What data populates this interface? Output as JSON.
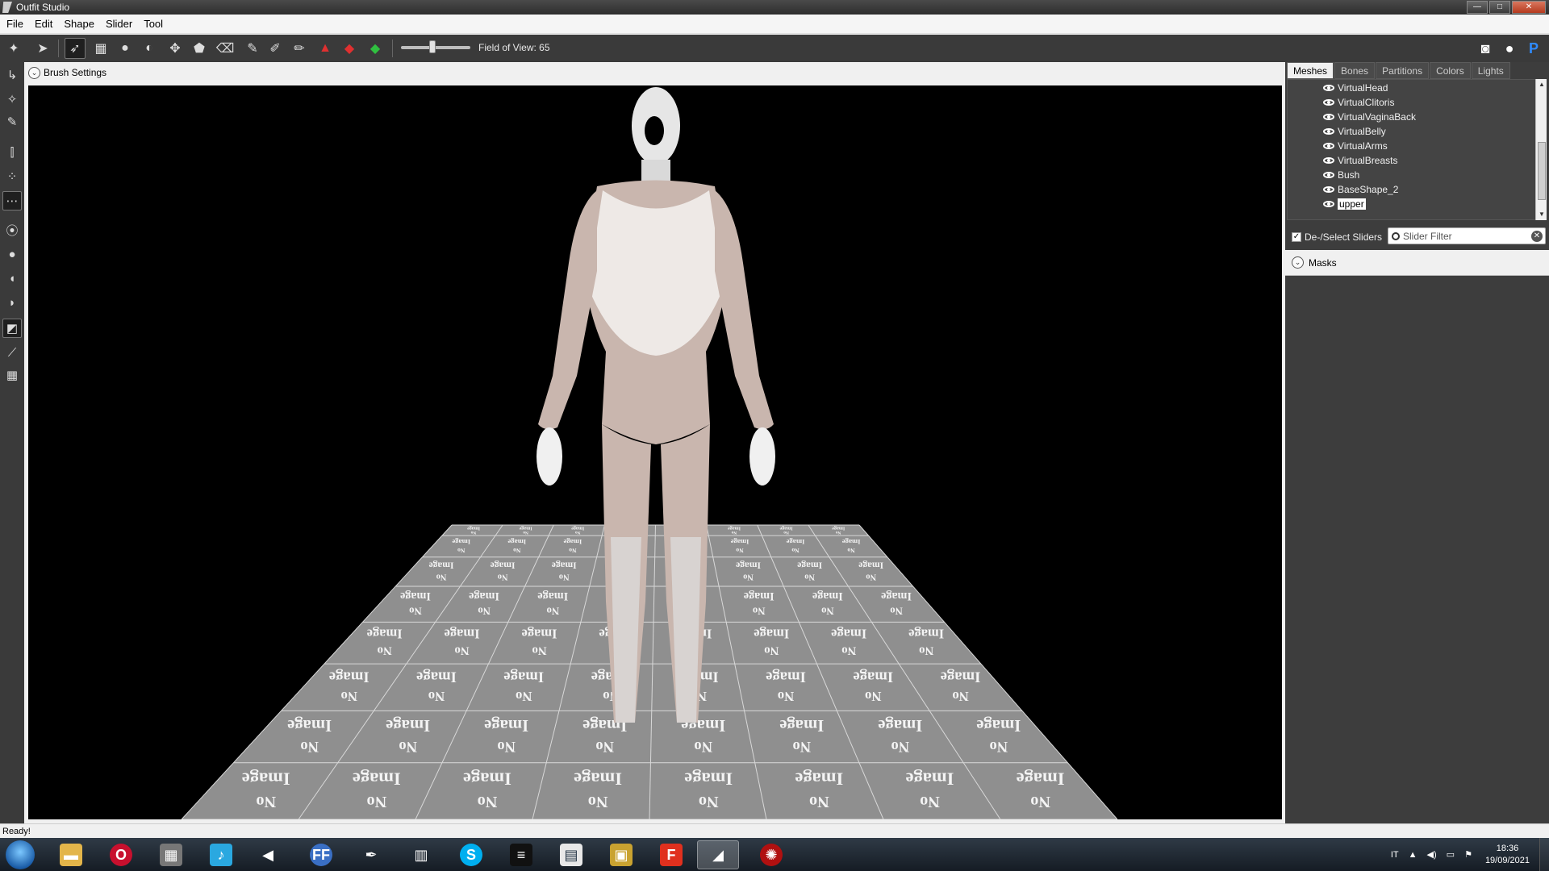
{
  "window": {
    "title": "Outfit Studio",
    "controls": {
      "minimize": "—",
      "maximize": "□",
      "close": "✕"
    }
  },
  "menu": [
    "File",
    "Edit",
    "Shape",
    "Slider",
    "Tool"
  ],
  "toolbar": {
    "field_of_view_label": "Field of View: 65",
    "field_of_view_value": 65,
    "active_tool": "select-brush"
  },
  "brush_settings": {
    "label": "Brush Settings"
  },
  "right_panel": {
    "tabs": [
      "Meshes",
      "Bones",
      "Partitions",
      "Colors",
      "Lights"
    ],
    "active_tab": "Meshes",
    "meshes": [
      {
        "name": "VirtualHead",
        "selected": false
      },
      {
        "name": "VirtualClitoris",
        "selected": false
      },
      {
        "name": "VirtualVaginaBack",
        "selected": false
      },
      {
        "name": "VirtualBelly",
        "selected": false
      },
      {
        "name": "VirtualArms",
        "selected": false
      },
      {
        "name": "VirtualBreasts",
        "selected": false
      },
      {
        "name": "Bush",
        "selected": false
      },
      {
        "name": "BaseShape_2",
        "selected": false
      },
      {
        "name": "upper",
        "selected": true
      }
    ],
    "deselect_sliders": {
      "label": "De-/Select Sliders",
      "checked": true
    },
    "slider_filter": {
      "placeholder": "Slider Filter",
      "value": ""
    },
    "masks": {
      "label": "Masks"
    }
  },
  "viewport": {
    "floor_tile_text_top": "Image",
    "floor_tile_text_bottom": "No"
  },
  "status": {
    "text": "Ready!"
  },
  "taskbar": {
    "language": "IT",
    "time": "18:36",
    "date": "19/09/2021"
  },
  "colors": {
    "dark_ui": "#3a3a3a",
    "viewport_bg": "#000000",
    "floor": "#8f8f8f"
  }
}
